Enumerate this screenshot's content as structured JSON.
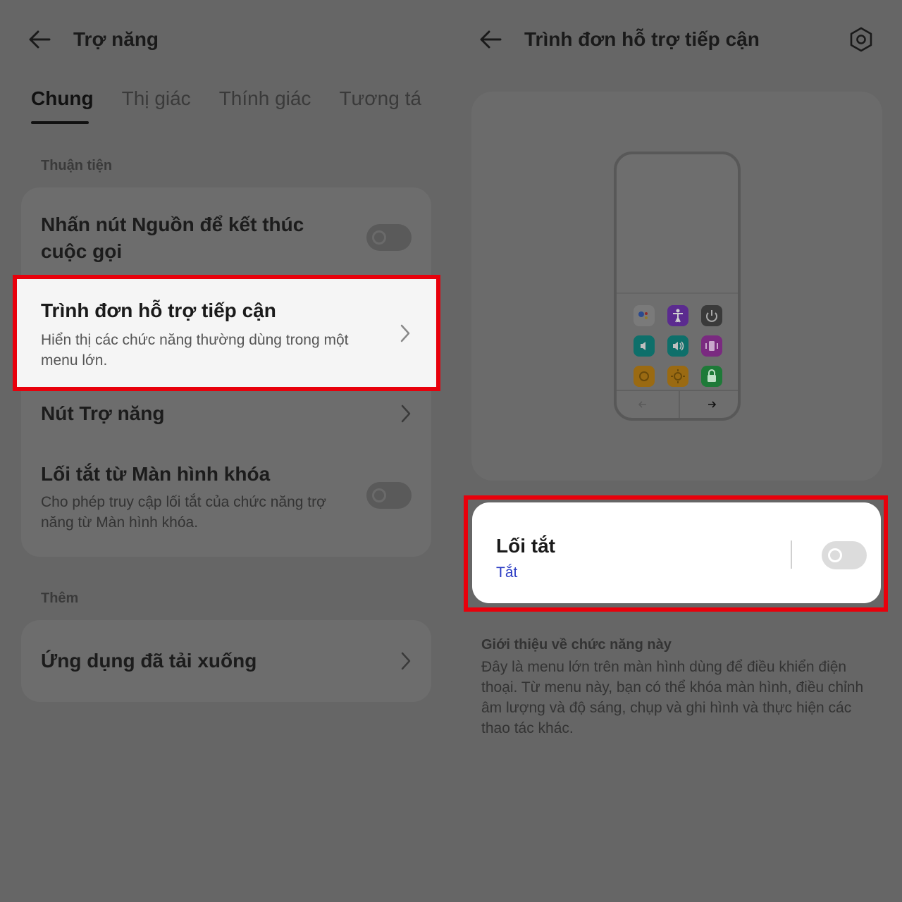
{
  "left": {
    "title": "Trợ năng",
    "tabs": [
      "Chung",
      "Thị giác",
      "Thính giác",
      "Tương tá"
    ],
    "sections": [
      {
        "label": "Thuận tiện",
        "items": [
          {
            "title": "Nhấn nút Nguồn để kết thúc cuộc gọi",
            "type": "toggle",
            "on": false
          },
          {
            "title": "Trình đơn hỗ trợ tiếp cận",
            "subtitle": "Hiển thị các chức năng thường dùng trong một menu lớn.",
            "type": "link",
            "highlighted": true
          },
          {
            "title": "Nút Trợ năng",
            "type": "link"
          },
          {
            "title": "Lối tắt từ Màn hình khóa",
            "subtitle": "Cho phép truy cập lối tắt của chức năng trợ năng từ Màn hình khóa.",
            "type": "toggle",
            "on": false
          }
        ]
      },
      {
        "label": "Thêm",
        "items": [
          {
            "title": "Ứng dụng đã tải xuống",
            "type": "link"
          }
        ]
      }
    ]
  },
  "right": {
    "title": "Trình đơn hỗ trợ tiếp cận",
    "settings_icon": "settings-hexagon-icon",
    "preview_icons": [
      {
        "name": "assistant-icon",
        "color": "#7a7a7a"
      },
      {
        "name": "accessibility-icon",
        "color": "#5b2b8f"
      },
      {
        "name": "power-icon",
        "color": "#3a3a3a"
      },
      {
        "name": "volume-down-icon",
        "color": "#0e6f6a"
      },
      {
        "name": "volume-up-icon",
        "color": "#0e6f6a"
      },
      {
        "name": "vibrate-icon",
        "color": "#7a2a80"
      },
      {
        "name": "brightness-down-icon",
        "color": "#9a6a12"
      },
      {
        "name": "brightness-up-icon",
        "color": "#9a6a12"
      },
      {
        "name": "lock-icon",
        "color": "#1e7a38"
      }
    ],
    "shortcut": {
      "title": "Lối tắt",
      "status": "Tắt",
      "on": false
    },
    "intro": {
      "title": "Giới thiệu về chức năng này",
      "body": "Đây là menu lớn trên màn hình dùng để điều khiển điện thoại. Từ menu này, bạn có thể khóa màn hình, điều chỉnh âm lượng và độ sáng, chụp và ghi hình và thực hiện các thao tác khác."
    },
    "highlight_color": "#e8000b",
    "accent_color": "#2b3cc4"
  }
}
